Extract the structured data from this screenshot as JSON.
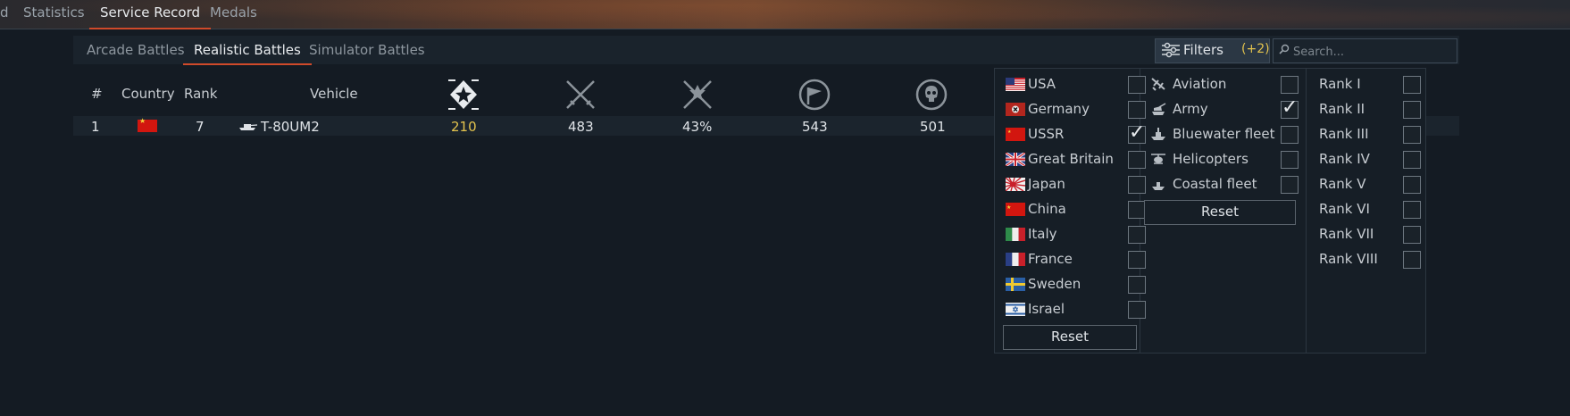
{
  "main_tabs": [
    {
      "label": "d"
    },
    {
      "label": "Statistics"
    },
    {
      "label": "Service Record"
    },
    {
      "label": "Medals"
    }
  ],
  "sub_tabs": [
    {
      "label": "Arcade Battles"
    },
    {
      "label": "Realistic Battles"
    },
    {
      "label": "Simulator Battles"
    }
  ],
  "filters": {
    "label": "Filters",
    "count": "(+2)"
  },
  "search": {
    "placeholder": "Search..."
  },
  "table": {
    "headers": {
      "num": "#",
      "country": "Country",
      "rank": "Rank",
      "vehicle": "Vehicle"
    },
    "icon_columns": [
      "battles-icon",
      "victories-icon",
      "win-rate-icon",
      "respawns-icon",
      "kills-icon"
    ],
    "rows": [
      {
        "num": "1",
        "country": "USSR",
        "rank": "7",
        "vehicle": "T-80UM2",
        "battles": "210",
        "victories": "483",
        "win_rate": "43%",
        "respawns": "543",
        "kills": "501"
      }
    ]
  },
  "dropdown": {
    "countries": [
      {
        "label": "USA",
        "checked": false
      },
      {
        "label": "Germany",
        "checked": false
      },
      {
        "label": "USSR",
        "checked": true
      },
      {
        "label": "Great Britain",
        "checked": false
      },
      {
        "label": "Japan",
        "checked": false
      },
      {
        "label": "China",
        "checked": false
      },
      {
        "label": "Italy",
        "checked": false
      },
      {
        "label": "France",
        "checked": false
      },
      {
        "label": "Sweden",
        "checked": false
      },
      {
        "label": "Israel",
        "checked": false
      }
    ],
    "types": [
      {
        "label": "Aviation",
        "icon": "plane-icon",
        "checked": false
      },
      {
        "label": "Army",
        "icon": "tank-icon",
        "checked": true
      },
      {
        "label": "Bluewater fleet",
        "icon": "ship-icon",
        "checked": false
      },
      {
        "label": "Helicopters",
        "icon": "helicopter-icon",
        "checked": false
      },
      {
        "label": "Coastal fleet",
        "icon": "boat-icon",
        "checked": false
      }
    ],
    "ranks": [
      {
        "label": "Rank I",
        "checked": false
      },
      {
        "label": "Rank II",
        "checked": false
      },
      {
        "label": "Rank III",
        "checked": false
      },
      {
        "label": "Rank IV",
        "checked": false
      },
      {
        "label": "Rank V",
        "checked": false
      },
      {
        "label": "Rank VI",
        "checked": false
      },
      {
        "label": "Rank VII",
        "checked": false
      },
      {
        "label": "Rank VIII",
        "checked": false
      }
    ],
    "reset_label": "Reset"
  },
  "colors": {
    "accent_underline": "#d04a2a",
    "gold": "#e3c34e",
    "background": "#141b23"
  }
}
